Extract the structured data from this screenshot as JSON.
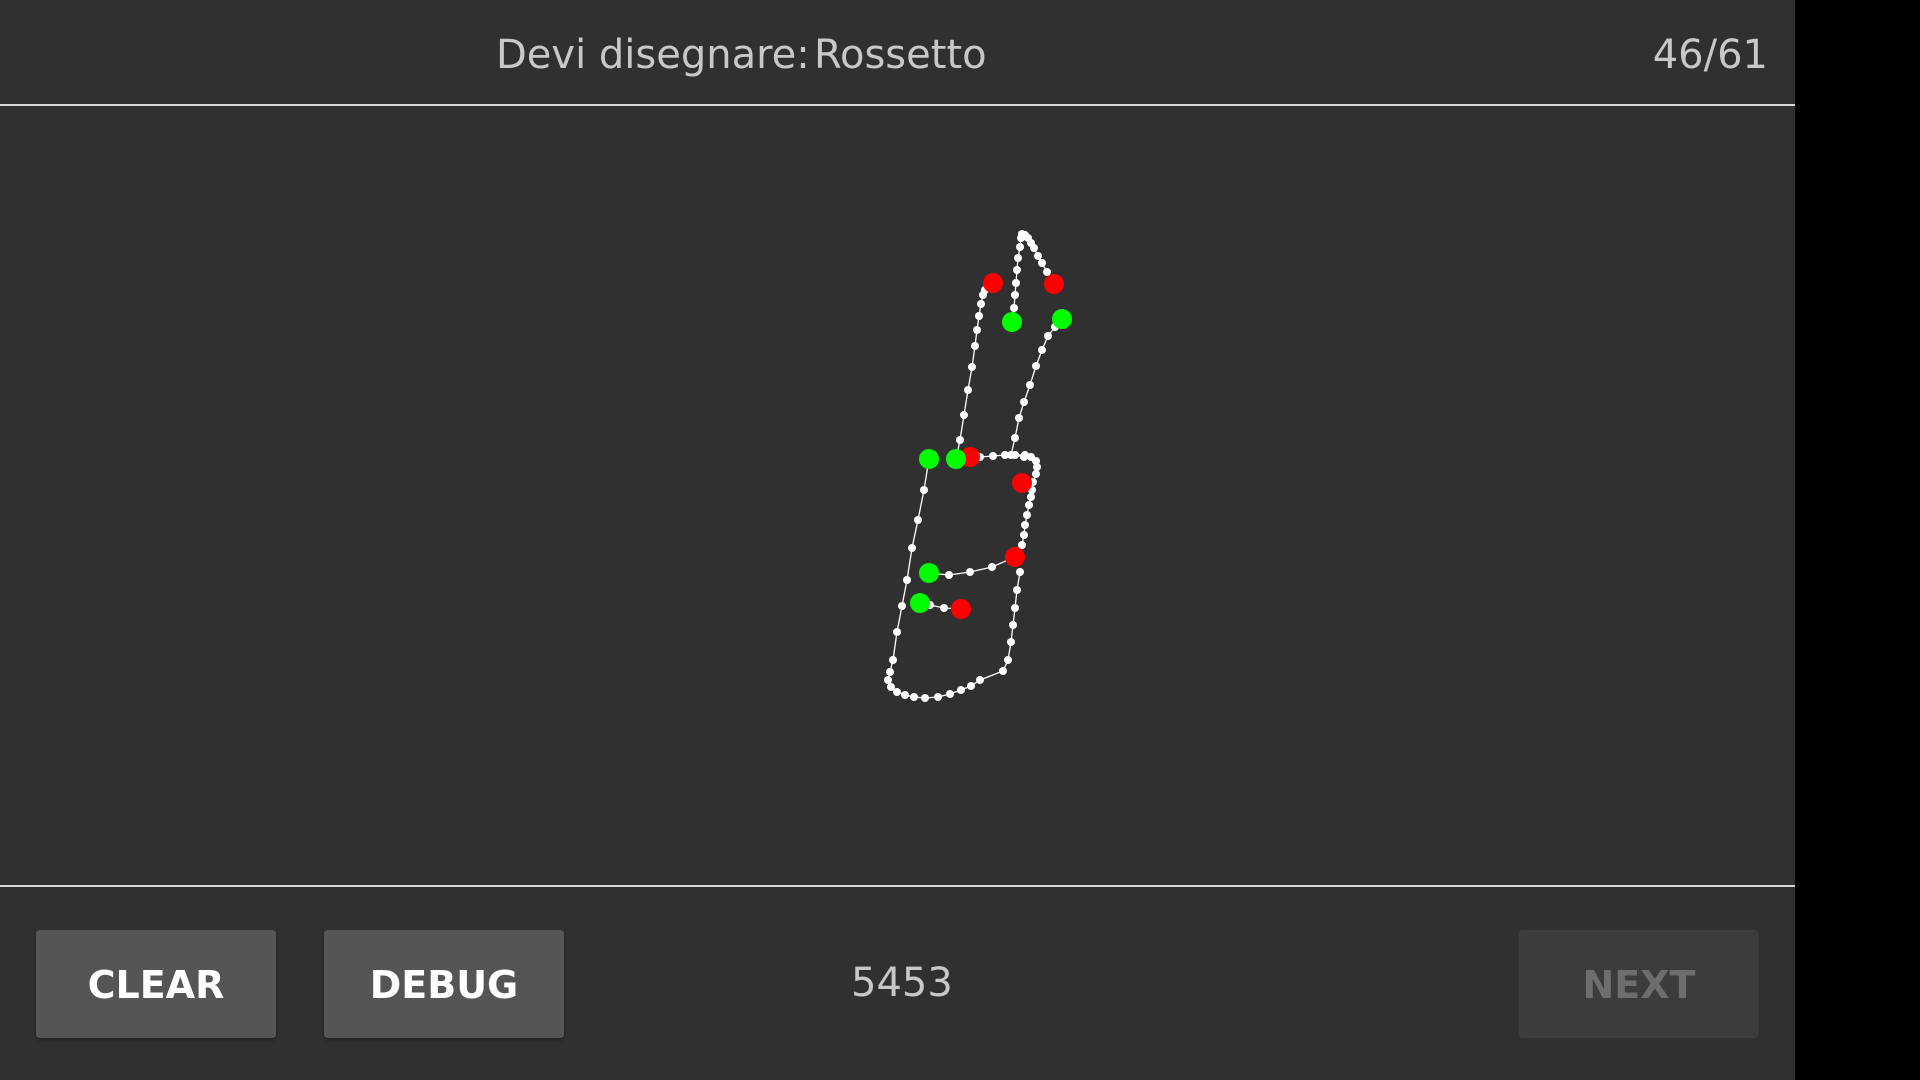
{
  "header": {
    "prompt_label": "Devi disegnare:",
    "prompt_word": "Rossetto",
    "progress": "46/61"
  },
  "drawing": {
    "stroke_color": "#ffffff",
    "start_point_color": "#00ff00",
    "end_point_color": "#ff0000"
  },
  "footer": {
    "clear_label": "CLEAR",
    "debug_label": "DEBUG",
    "score": "5453",
    "next_label": "NEXT",
    "next_enabled": false
  },
  "colors": {
    "background": "#303030",
    "text": "#c8c8c8",
    "button": "#555558",
    "button_disabled": "#3c3c3c"
  }
}
